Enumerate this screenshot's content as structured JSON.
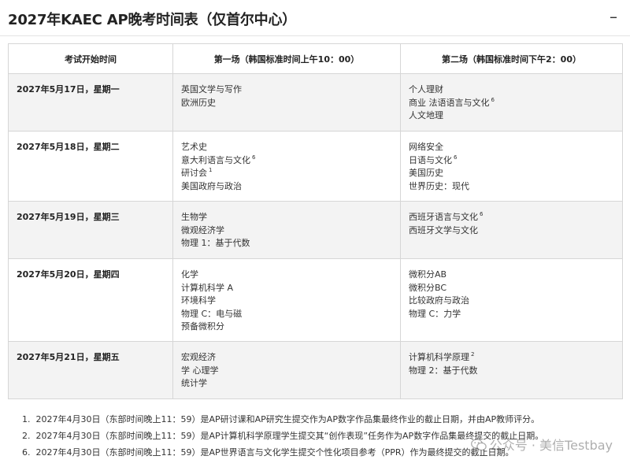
{
  "header": {
    "title": "2027年KAEC AP晚考时间表（仅首尔中心）",
    "collapse_symbol": "–"
  },
  "table": {
    "headers": [
      "考试开始时间",
      "第一场（韩国标准时间上午10：00）",
      "第二场（韩国标准时间下午2：00）"
    ],
    "rows": [
      {
        "date": "2027年5月17日，星期一",
        "session1": [
          {
            "text": "英国文学与写作",
            "sup": ""
          },
          {
            "text": "欧洲历史",
            "sup": ""
          }
        ],
        "session2": [
          {
            "text": "个人理财",
            "sup": ""
          },
          {
            "text": "商业 法语语言与文化",
            "sup": "6"
          },
          {
            "text": "人文地理",
            "sup": ""
          }
        ]
      },
      {
        "date": "2027年5月18日，星期二",
        "session1": [
          {
            "text": "艺术史",
            "sup": ""
          },
          {
            "text": "意大利语言与文化",
            "sup": "6"
          },
          {
            "text": "研讨会",
            "sup": "1"
          },
          {
            "text": "美国政府与政治",
            "sup": ""
          }
        ],
        "session2": [
          {
            "text": "网络安全",
            "sup": ""
          },
          {
            "text": "日语与文化",
            "sup": "6"
          },
          {
            "text": "美国历史",
            "sup": ""
          },
          {
            "text": "世界历史：现代",
            "sup": ""
          }
        ]
      },
      {
        "date": "2027年5月19日，星期三",
        "session1": [
          {
            "text": "生物学",
            "sup": ""
          },
          {
            "text": "微观经济学",
            "sup": ""
          },
          {
            "text": "物理 1：基于代数",
            "sup": ""
          }
        ],
        "session2": [
          {
            "text": "西班牙语言与文化",
            "sup": "6"
          },
          {
            "text": "西班牙文学与文化",
            "sup": ""
          }
        ]
      },
      {
        "date": "2027年5月20日，星期四",
        "session1": [
          {
            "text": "化学",
            "sup": ""
          },
          {
            "text": "计算机科学 A",
            "sup": ""
          },
          {
            "text": "环境科学",
            "sup": ""
          },
          {
            "text": "物理 C：电与磁",
            "sup": ""
          },
          {
            "text": "预备微积分",
            "sup": ""
          }
        ],
        "session2": [
          {
            "text": "微积分AB",
            "sup": ""
          },
          {
            "text": "微积分BC",
            "sup": ""
          },
          {
            "text": "比较政府与政治",
            "sup": ""
          },
          {
            "text": "物理 C：力学",
            "sup": ""
          }
        ]
      },
      {
        "date": "2027年5月21日，星期五",
        "session1": [
          {
            "text": "宏观经济",
            "sup": ""
          },
          {
            "text": "学 心理学",
            "sup": ""
          },
          {
            "text": "统计学",
            "sup": ""
          }
        ],
        "session2": [
          {
            "text": "计算机科学原理",
            "sup": "2"
          },
          {
            "text": "物理 2：基于代数",
            "sup": ""
          }
        ]
      }
    ]
  },
  "footnotes": [
    {
      "num": "1.",
      "text": "2027年4月30日（东部时间晚上11：59）是AP研讨课和AP研究生提交作为AP数字作品集最终作业的截止日期，并由AP教师评分。"
    },
    {
      "num": "2.",
      "text": "2027年4月30日（东部时间晚上11：59）是AP计算机科学原理学生提交其“创作表现”任务作为AP数字作品集最终提交的截止日期。"
    },
    {
      "num": "6.",
      "text": "2027年4月30日（东部时间晚上11：59）是AP世界语言与文化学生提交个性化项目参考（PPR）作为最终提交的截止日期。"
    }
  ],
  "watermark": {
    "text": "公众号 · 美信Testbay",
    "icon": "wechat-icon"
  }
}
